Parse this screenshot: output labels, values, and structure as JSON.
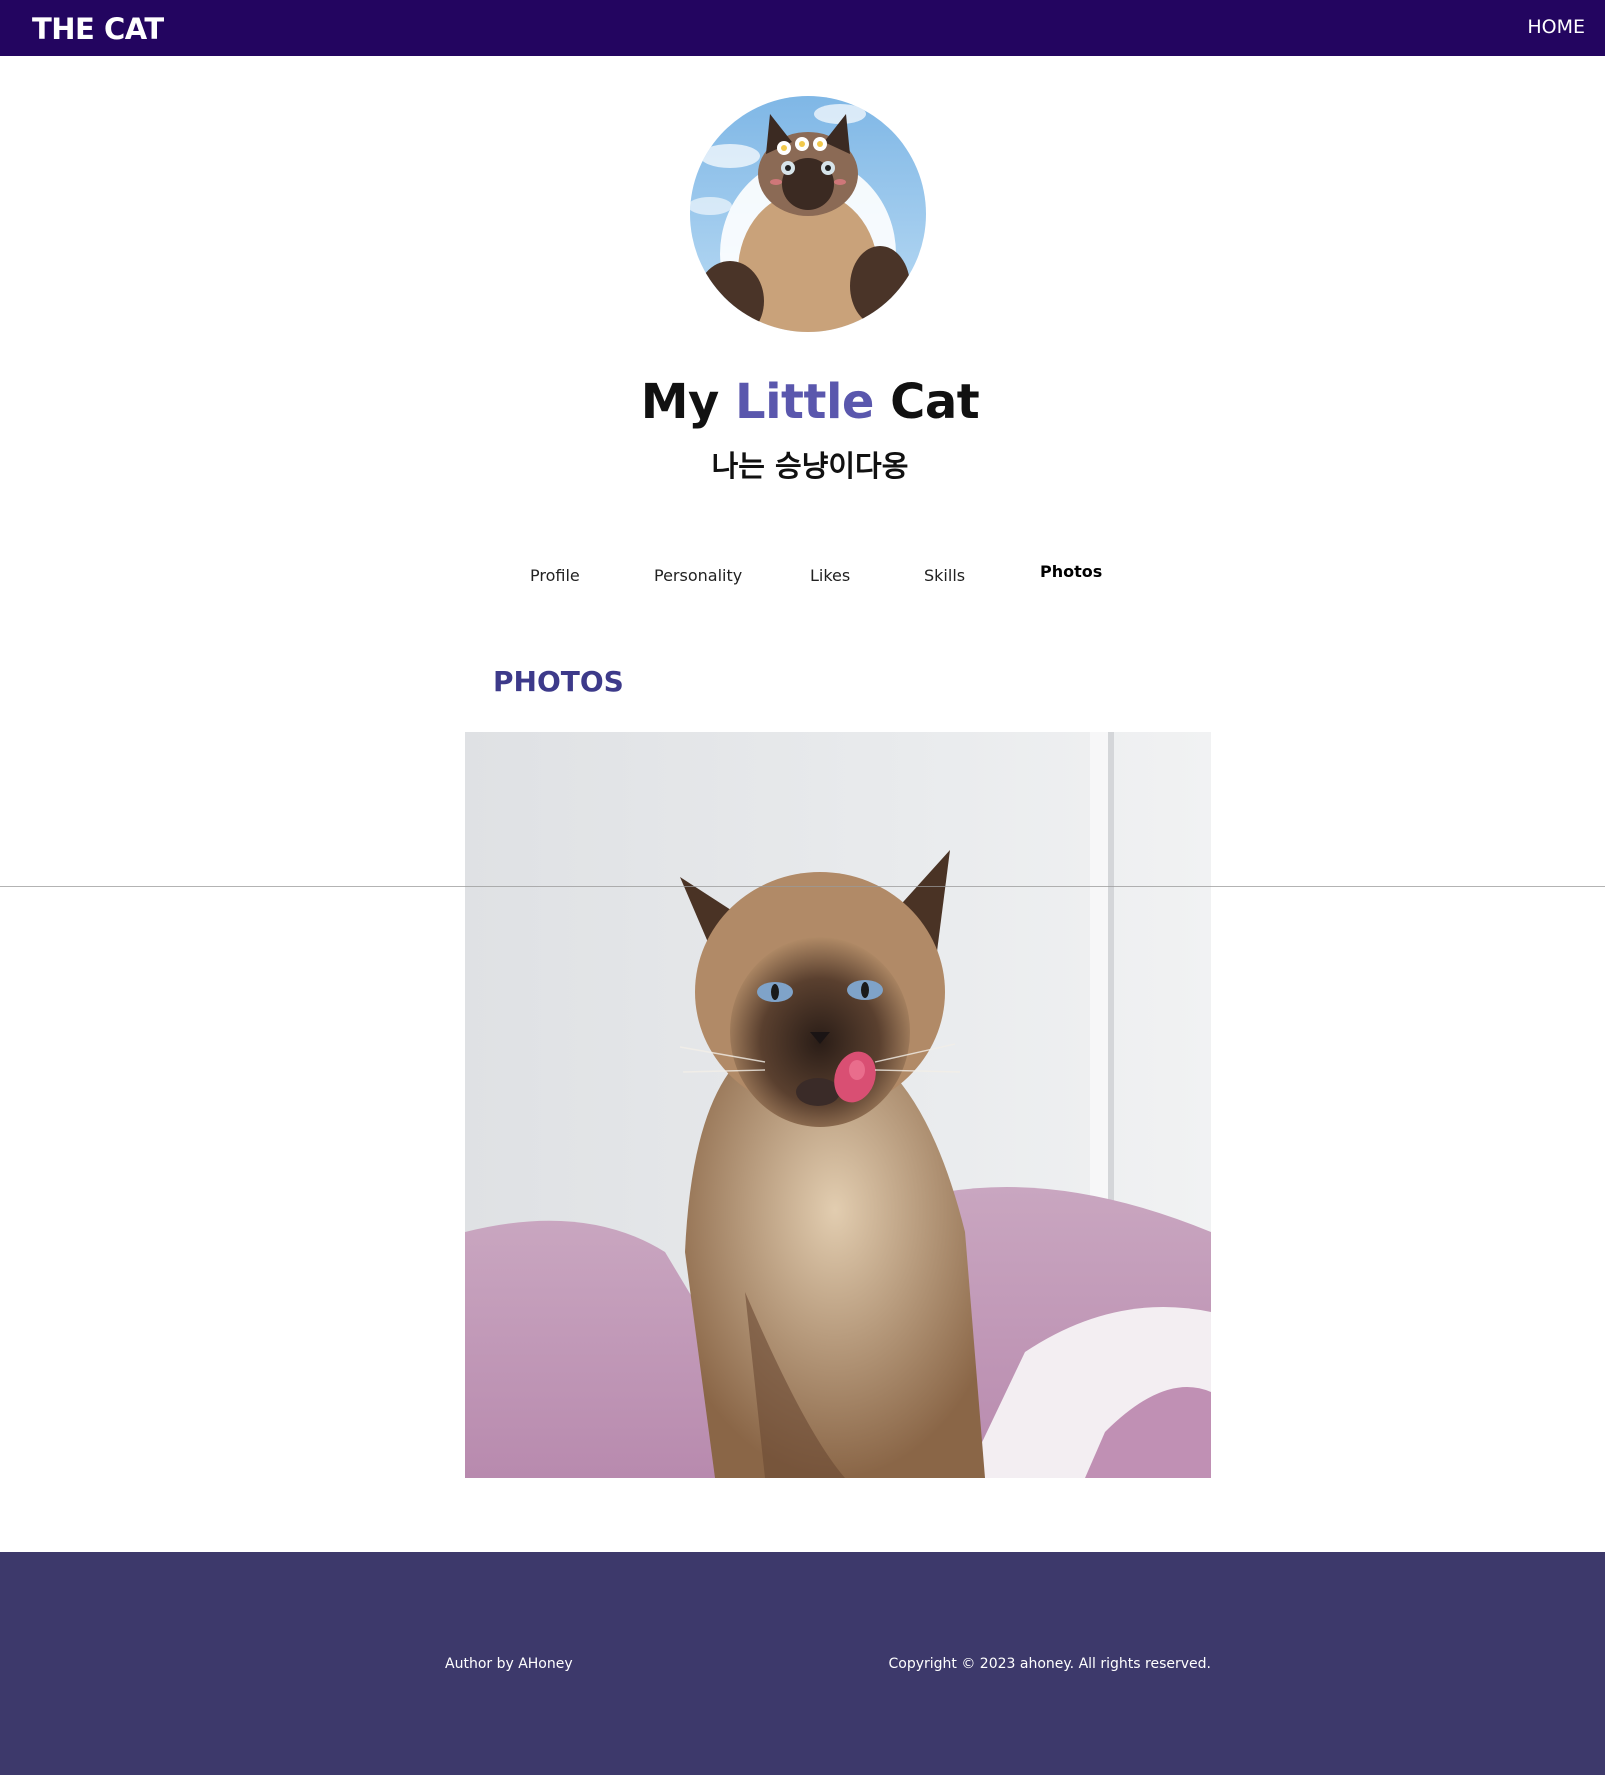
{
  "header": {
    "brand": "THE CAT",
    "nav_home": "HOME"
  },
  "hero": {
    "avatar_alt": "cat avatar",
    "title_part1": "My ",
    "title_accent": "Little",
    "title_part2": " Cat",
    "subtitle": "나는 승냥이다옹"
  },
  "tabs": [
    {
      "label": "Profile"
    },
    {
      "label": "Personality"
    },
    {
      "label": "Likes"
    },
    {
      "label": "Skills"
    },
    {
      "label": "Photos",
      "active": true
    }
  ],
  "section": {
    "title": "PHOTOS",
    "photo_alt": "siamese cat photo"
  },
  "footer": {
    "author": "Author by AHoney",
    "copyright": "Copyright © 2023 ahoney. All rights reserved."
  },
  "colors": {
    "topbar": "#230560",
    "accent": "#5a57ad",
    "section_title": "#3d3a8a",
    "footer": "#3d396b"
  }
}
